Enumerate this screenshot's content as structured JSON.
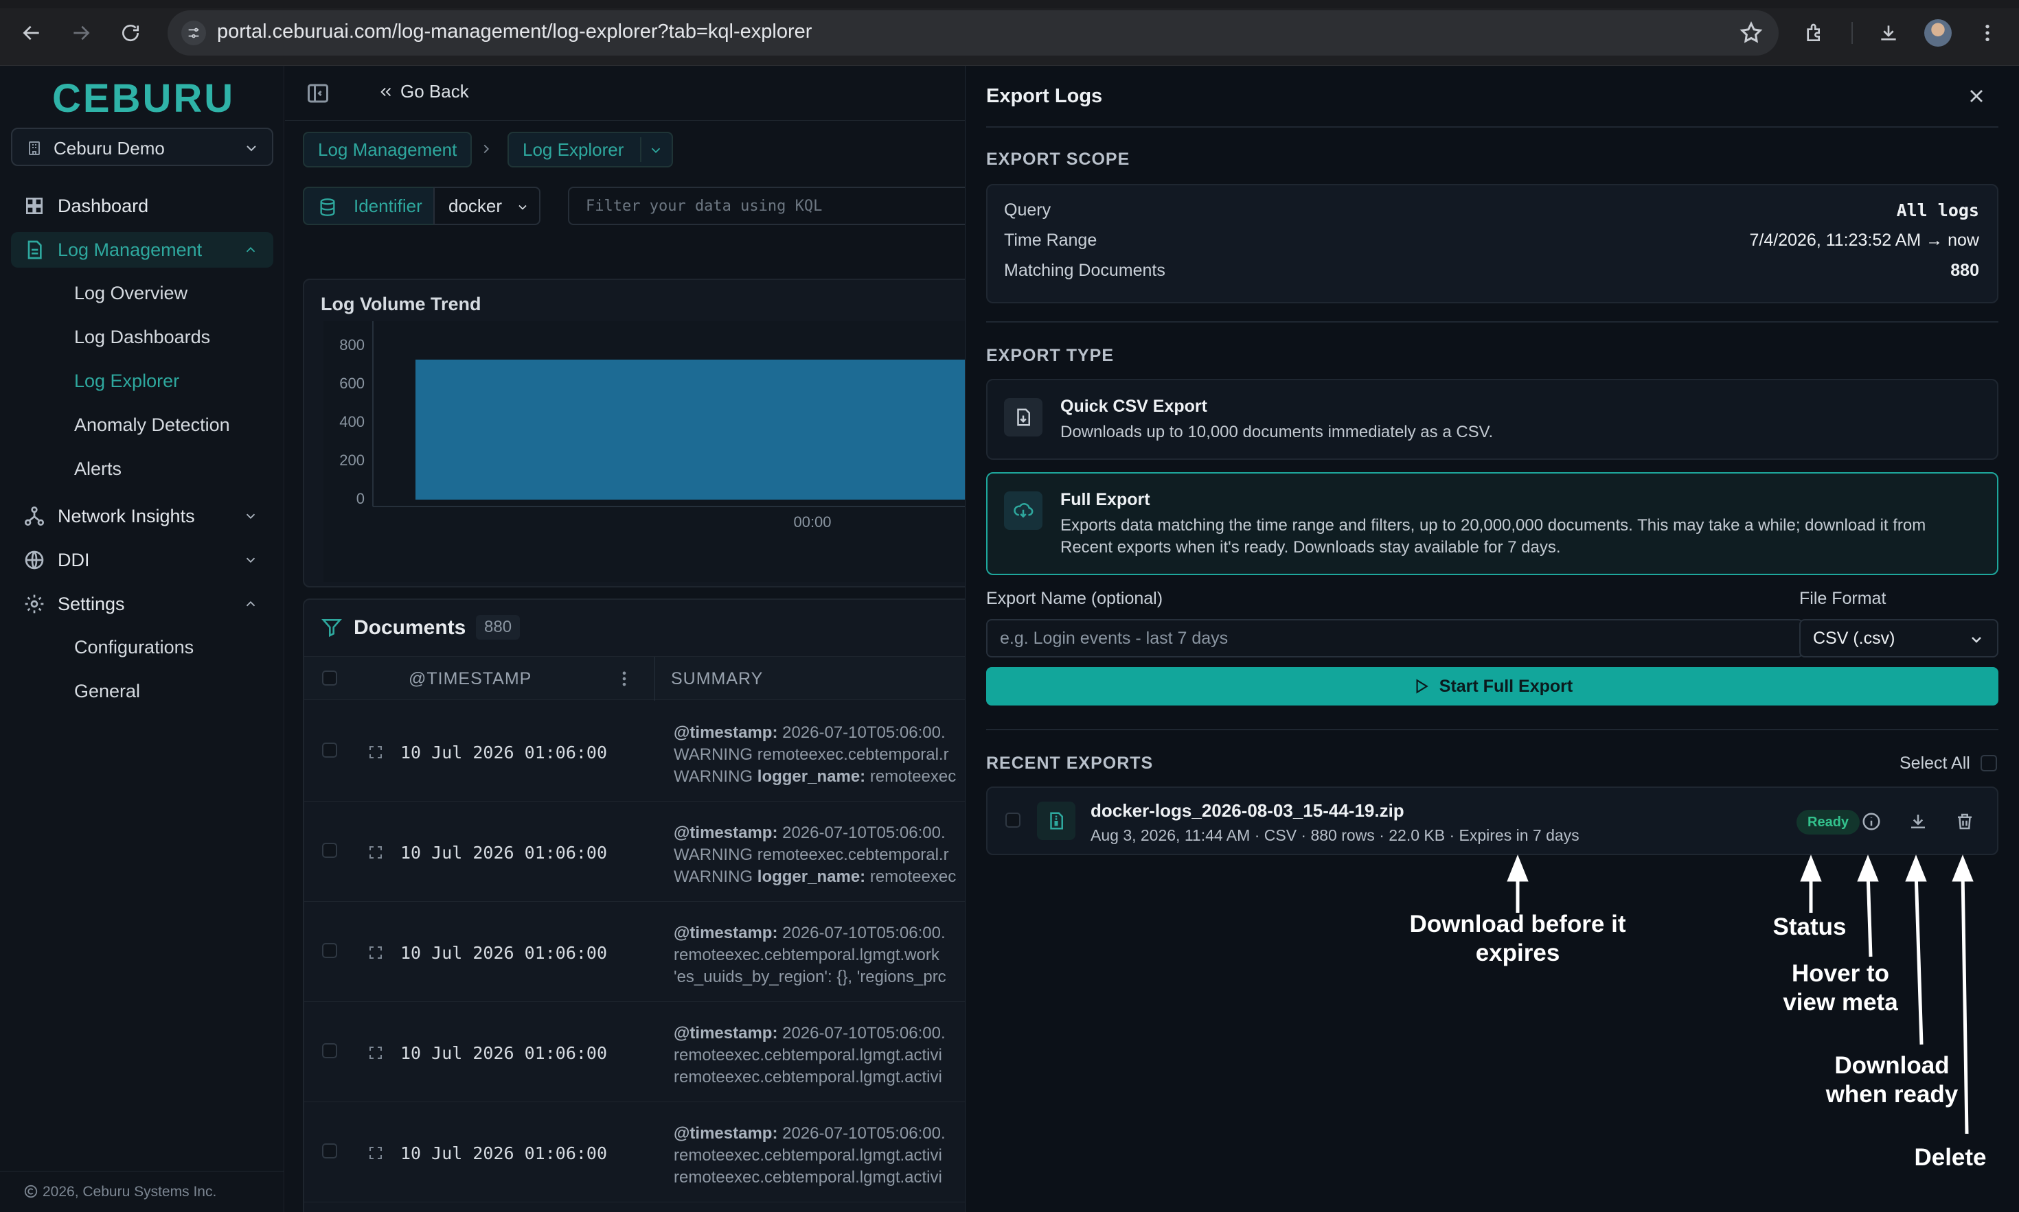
{
  "browser": {
    "url": "portal.ceburuai.com/log-management/log-explorer?tab=kql-explorer"
  },
  "sidebar": {
    "logo": "CEBURU",
    "org": "Ceburu Demo",
    "items": [
      {
        "label": "Dashboard"
      },
      {
        "label": "Log Management"
      },
      {
        "label": "Network Insights"
      },
      {
        "label": "DDI"
      },
      {
        "label": "Settings"
      }
    ],
    "log_sub": [
      "Log Overview",
      "Log Dashboards",
      "Log Explorer",
      "Anomaly Detection",
      "Alerts"
    ],
    "settings_sub": [
      "Configurations",
      "General"
    ],
    "footer": "2026, Ceburu Systems Inc."
  },
  "main": {
    "go_back": "Go Back",
    "breadcrumb": [
      "Log Management",
      "Log Explorer"
    ],
    "identifier": "Identifier",
    "source": "docker",
    "kql_placeholder": "Filter your data using KQL",
    "volume": {
      "title": "Log Volume Trend",
      "y_ticks": [
        "800",
        "600",
        "400",
        "200",
        "0"
      ],
      "x_tick": "00:00"
    },
    "documents": {
      "title": "Documents",
      "count": "880",
      "col_timestamp": "@TIMESTAMP",
      "col_summary": "SUMMARY",
      "rows": [
        {
          "ts": "10 Jul 2026 01:06:00",
          "l1k": "@timestamp:",
          "l1v": " 2026-07-10T05:06:00.",
          "l2": "WARNING remoteexec.cebtemporal.r",
          "l3k": "WARNING ",
          "l3b": "logger_name:",
          "l3v": " remoteexec"
        },
        {
          "ts": "10 Jul 2026 01:06:00",
          "l1k": "@timestamp:",
          "l1v": " 2026-07-10T05:06:00.",
          "l2": "WARNING remoteexec.cebtemporal.r",
          "l3k": "WARNING ",
          "l3b": "logger_name:",
          "l3v": " remoteexec"
        },
        {
          "ts": "10 Jul 2026 01:06:00",
          "l1k": "@timestamp:",
          "l1v": " 2026-07-10T05:06:00.",
          "l2": "remoteexec.cebtemporal.lgmgt.work",
          "l3k": "'es_uuids_by_region': {}, 'regions_prc",
          "l3b": "",
          "l3v": ""
        },
        {
          "ts": "10 Jul 2026 01:06:00",
          "l1k": "@timestamp:",
          "l1v": " 2026-07-10T05:06:00.",
          "l2": "remoteexec.cebtemporal.lgmgt.activi",
          "l3k": "remoteexec.cebtemporal.lgmgt.activi",
          "l3b": "",
          "l3v": ""
        },
        {
          "ts": "10 Jul 2026 01:06:00",
          "l1k": "@timestamp:",
          "l1v": " 2026-07-10T05:06:00.",
          "l2": "remoteexec.cebtemporal.lgmgt.activi",
          "l3k": "remoteexec.cebtemporal.lgmgt.activi",
          "l3b": "",
          "l3v": ""
        }
      ]
    }
  },
  "panel": {
    "title": "Export Logs",
    "scope_label": "EXPORT SCOPE",
    "scope": [
      {
        "k": "Query",
        "v": "All logs"
      },
      {
        "k": "Time Range",
        "v": "7/4/2026, 11:23:52 AM → now"
      },
      {
        "k": "Matching Documents",
        "v": "880"
      }
    ],
    "type_label": "EXPORT TYPE",
    "quick": {
      "title": "Quick CSV Export",
      "desc": "Downloads up to 10,000 documents immediately as a CSV."
    },
    "full": {
      "title": "Full Export",
      "desc": "Exports data matching the time range and filters, up to 20,000,000 documents. This may take a while; download it from Recent exports when it's ready. Downloads stay available for 7 days."
    },
    "name_label": "Export Name (optional)",
    "name_placeholder": "e.g. Login events - last 7 days",
    "format_label": "File Format",
    "format_value": "CSV (.csv)",
    "start_label": "Start Full Export",
    "recent_label": "RECENT EXPORTS",
    "select_all": "Select All",
    "export": {
      "file": "docker-logs_2026-08-03_15-44-19.zip",
      "meta": "Aug 3, 2026, 11:44 AM · CSV · 880 rows · 22.0 KB · Expires in 7 days",
      "status": "Ready"
    }
  },
  "annotations": {
    "download_expire": "Download before it expires",
    "status": "Status",
    "hover": "Hover to view meta",
    "download_ready": "Download when ready",
    "delete": "Delete"
  },
  "colors": {
    "accent": "#12a69b",
    "status_ready": "#33c28d"
  }
}
